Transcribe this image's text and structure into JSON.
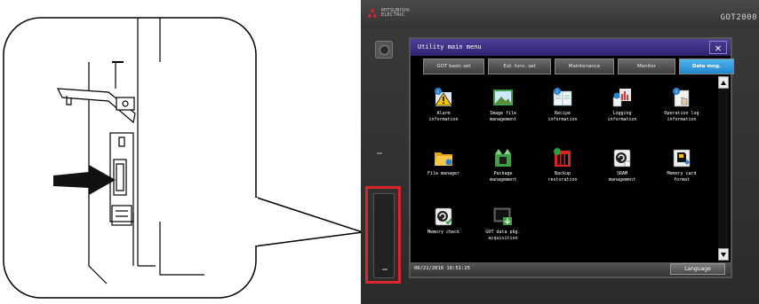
{
  "device": {
    "maker_line1": "MITSUBISHI",
    "maker_line2": "ELECTRIC",
    "brand": "GOT2000"
  },
  "screen": {
    "title": "Utility main menu",
    "close_symbol": "✕",
    "tabs": [
      {
        "label": "GOT basic set",
        "active": false
      },
      {
        "label": "Ext. func. set",
        "active": false
      },
      {
        "label": "Maintenance",
        "active": false
      },
      {
        "label": "Monitor",
        "active": false
      },
      {
        "label": "Data mng.",
        "active": true
      }
    ],
    "items": [
      {
        "label": "Alarm\ninformation",
        "icon": "alarm-info-icon"
      },
      {
        "label": "Image file\nmanagement",
        "icon": "image-file-icon"
      },
      {
        "label": "Recipe\ninformation",
        "icon": "recipe-book-icon"
      },
      {
        "label": "Logging\ninformation",
        "icon": "logging-icon"
      },
      {
        "label": "Operation log\ninformation",
        "icon": "operation-log-icon"
      },
      {
        "label": "File manager",
        "icon": "folder-icon"
      },
      {
        "label": "Package\nmanagement",
        "icon": "package-icon"
      },
      {
        "label": "Backup\nrestoration",
        "icon": "backup-icon"
      },
      {
        "label": "SRAM\nmanagement",
        "icon": "sram-icon"
      },
      {
        "label": "Memory card\nformat",
        "icon": "memory-card-icon"
      },
      {
        "label": "Memory check",
        "icon": "memory-check-icon"
      },
      {
        "label": "GOT data pkg.\nacquisition",
        "icon": "data-pkg-icon"
      }
    ],
    "datetime": "06/21/2016 18:51:25",
    "language_label": "Language"
  },
  "colors": {
    "title_bar": "#3a2f86",
    "active_tab": "#2a97dc",
    "highlight_frame": "#d9252b"
  }
}
